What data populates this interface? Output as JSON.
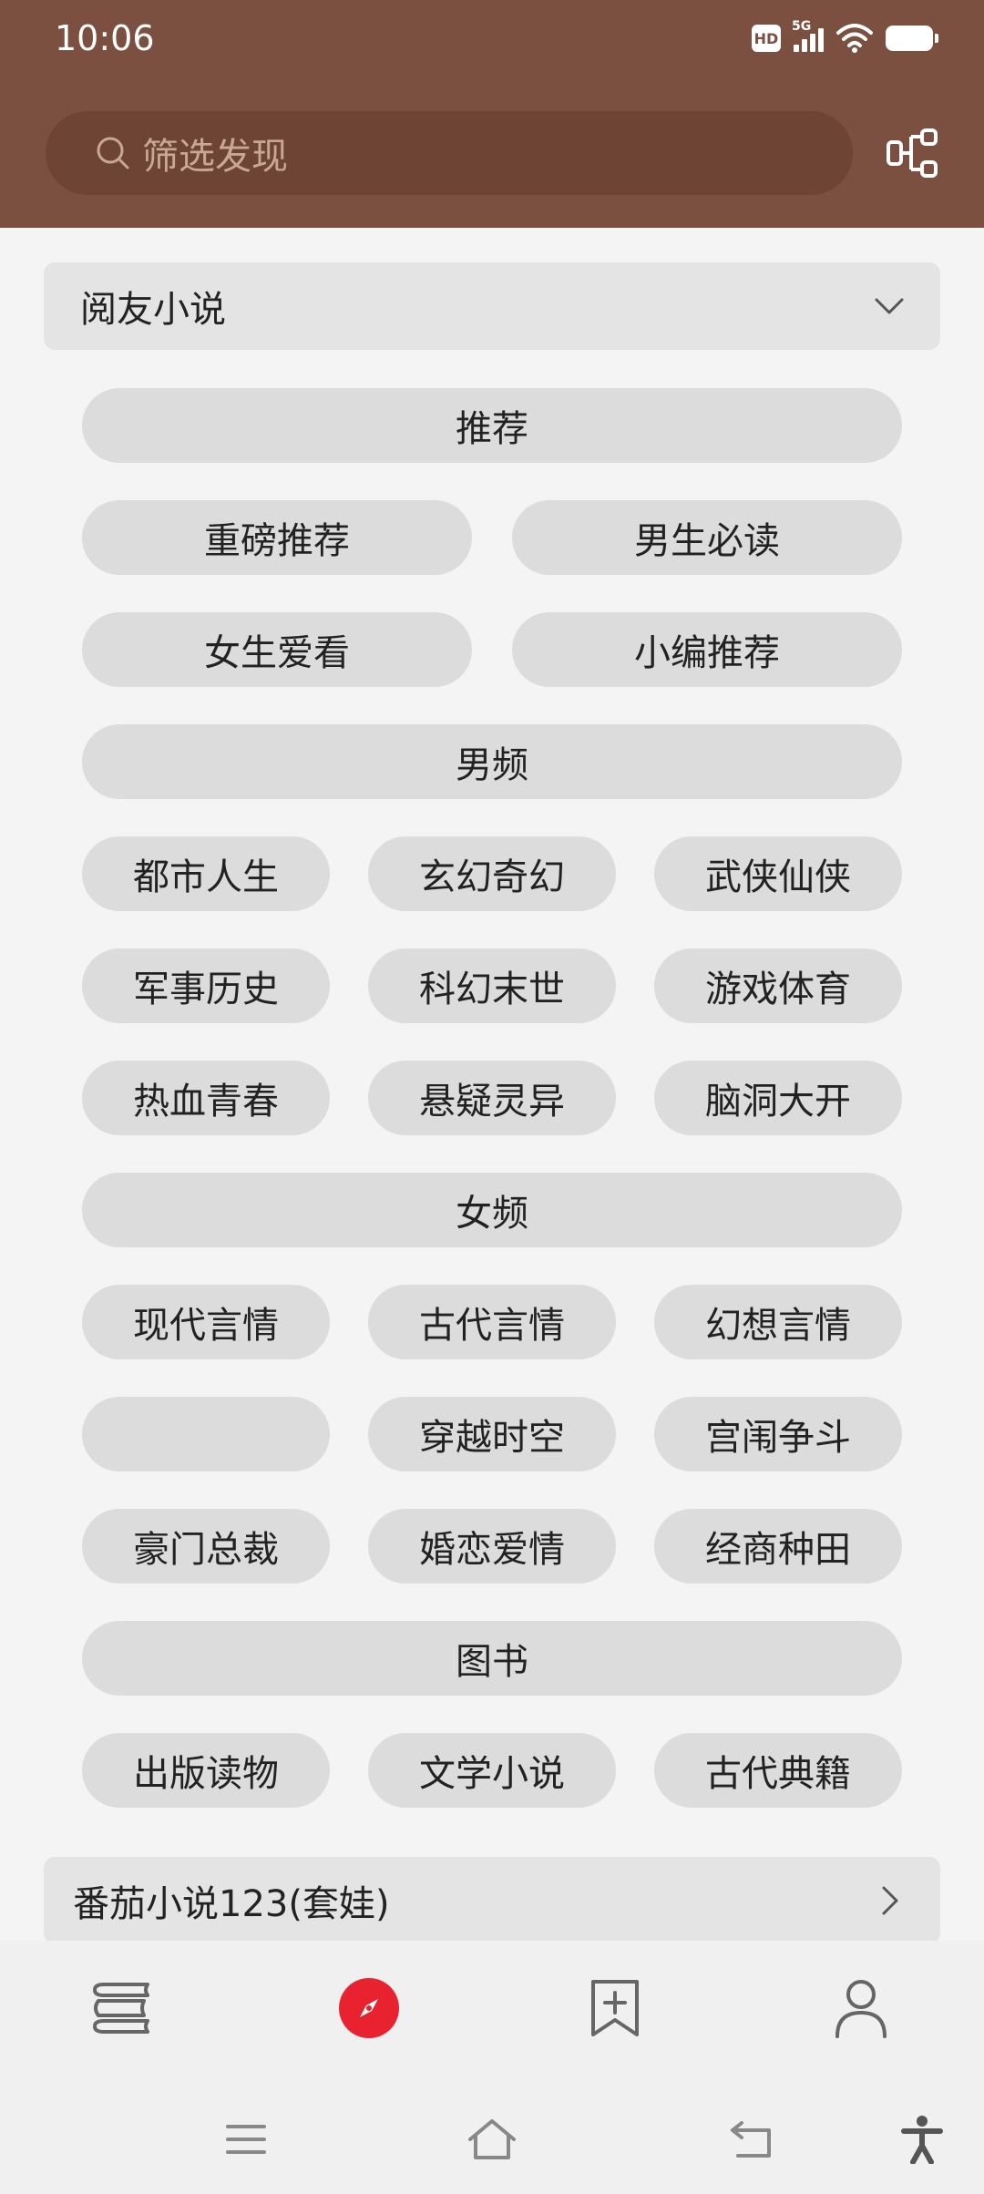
{
  "status_bar": {
    "time": "10:06",
    "hd": "HD",
    "network": "5G"
  },
  "search": {
    "placeholder": "筛选发现"
  },
  "groups": [
    {
      "title": "阅友小说",
      "expanded": true
    },
    {
      "title": "番茄小说123(套娃)",
      "expanded": false
    }
  ],
  "chips": {
    "recommend_header": "推荐",
    "recommend": [
      "重磅推荐",
      "男生必读",
      "女生爱看",
      "小编推荐"
    ],
    "male_header": "男频",
    "male": [
      "都市人生",
      "玄幻奇幻",
      "武侠仙侠",
      "军事历史",
      "科幻末世",
      "游戏体育",
      "热血青春",
      "悬疑灵异",
      "脑洞大开"
    ],
    "female_header": "女频",
    "female": [
      "现代言情",
      "古代言情",
      "幻想言情",
      "",
      "穿越时空",
      "宫闱争斗",
      "豪门总裁",
      "婚恋爱情",
      "经商种田"
    ],
    "books_header": "图书",
    "books": [
      "出版读物",
      "文学小说",
      "古代典籍"
    ]
  },
  "bottom_nav": {
    "items": [
      {
        "icon": "bookshelf-icon",
        "active": false
      },
      {
        "icon": "compass-icon",
        "active": true
      },
      {
        "icon": "rss-bookmark-icon",
        "active": false
      },
      {
        "icon": "profile-icon",
        "active": false
      }
    ]
  },
  "colors": {
    "header_bg": "#7c5040",
    "search_bg": "#6e4434",
    "accent": "#e8232f",
    "chip_bg": "#dcdcdc"
  }
}
